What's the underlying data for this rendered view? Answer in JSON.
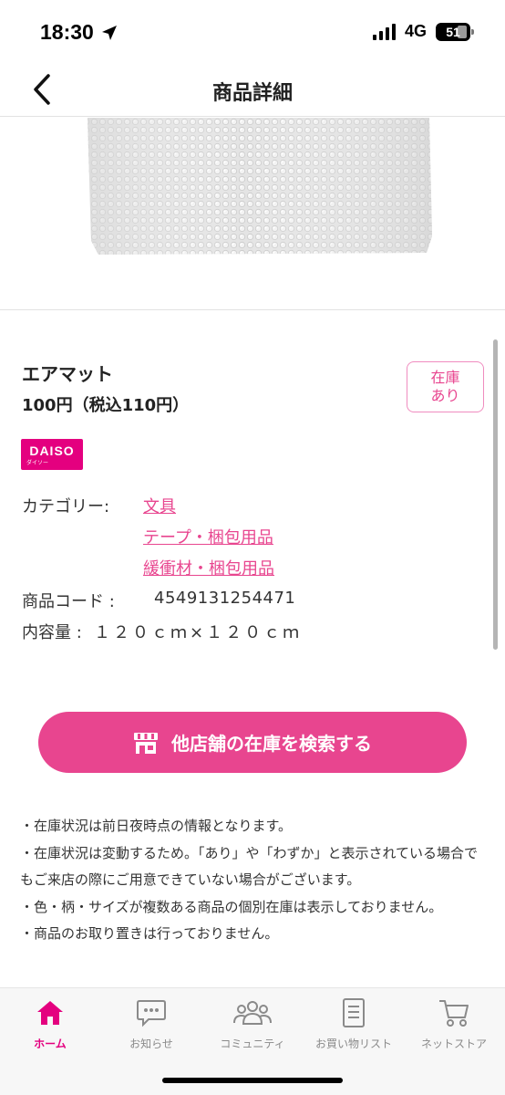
{
  "status_bar": {
    "time": "18:30",
    "network": "4G",
    "battery": "51"
  },
  "header": {
    "title": "商品詳細"
  },
  "product": {
    "name": "エアマット",
    "price": "100円（税込110円）",
    "stock_badge": [
      "在庫",
      "あり"
    ],
    "brand": {
      "logo_text": "DAISO",
      "logo_sub": "ダイソー"
    },
    "category_label": "カテゴリー:",
    "categories": [
      "文具",
      "テープ・梱包用品",
      "緩衝材・梱包用品"
    ],
    "code_label": "商品コード :",
    "code_value": "4549131254471",
    "capacity_label": "内容量 :",
    "capacity_value": "１２０ｃｍ×１２０ｃｍ"
  },
  "actions": {
    "search_stores_label": "他店舗の在庫を検索する"
  },
  "notes": [
    "・在庫状況は前日夜時点の情報となります。",
    "・在庫状況は変動するため。「あり」や「わずか」と表示されている場合でもご来店の際にご用意できていない場合がございます。",
    "・色・柄・サイズが複数ある商品の個別在庫は表示しておりません。",
    "・商品のお取り置きは行っておりません。"
  ],
  "tab_bar": {
    "items": [
      {
        "label": "ホーム",
        "icon": "home-icon",
        "active": true
      },
      {
        "label": "お知らせ",
        "icon": "chat-bubble-icon",
        "active": false
      },
      {
        "label": "コミュニティ",
        "icon": "people-icon",
        "active": false
      },
      {
        "label": "お買い物リスト",
        "icon": "document-list-icon",
        "active": false
      },
      {
        "label": "ネットストア",
        "icon": "cart-icon",
        "active": false
      }
    ]
  },
  "colors": {
    "accent": "#e8458f",
    "brand": "#e4007f"
  }
}
